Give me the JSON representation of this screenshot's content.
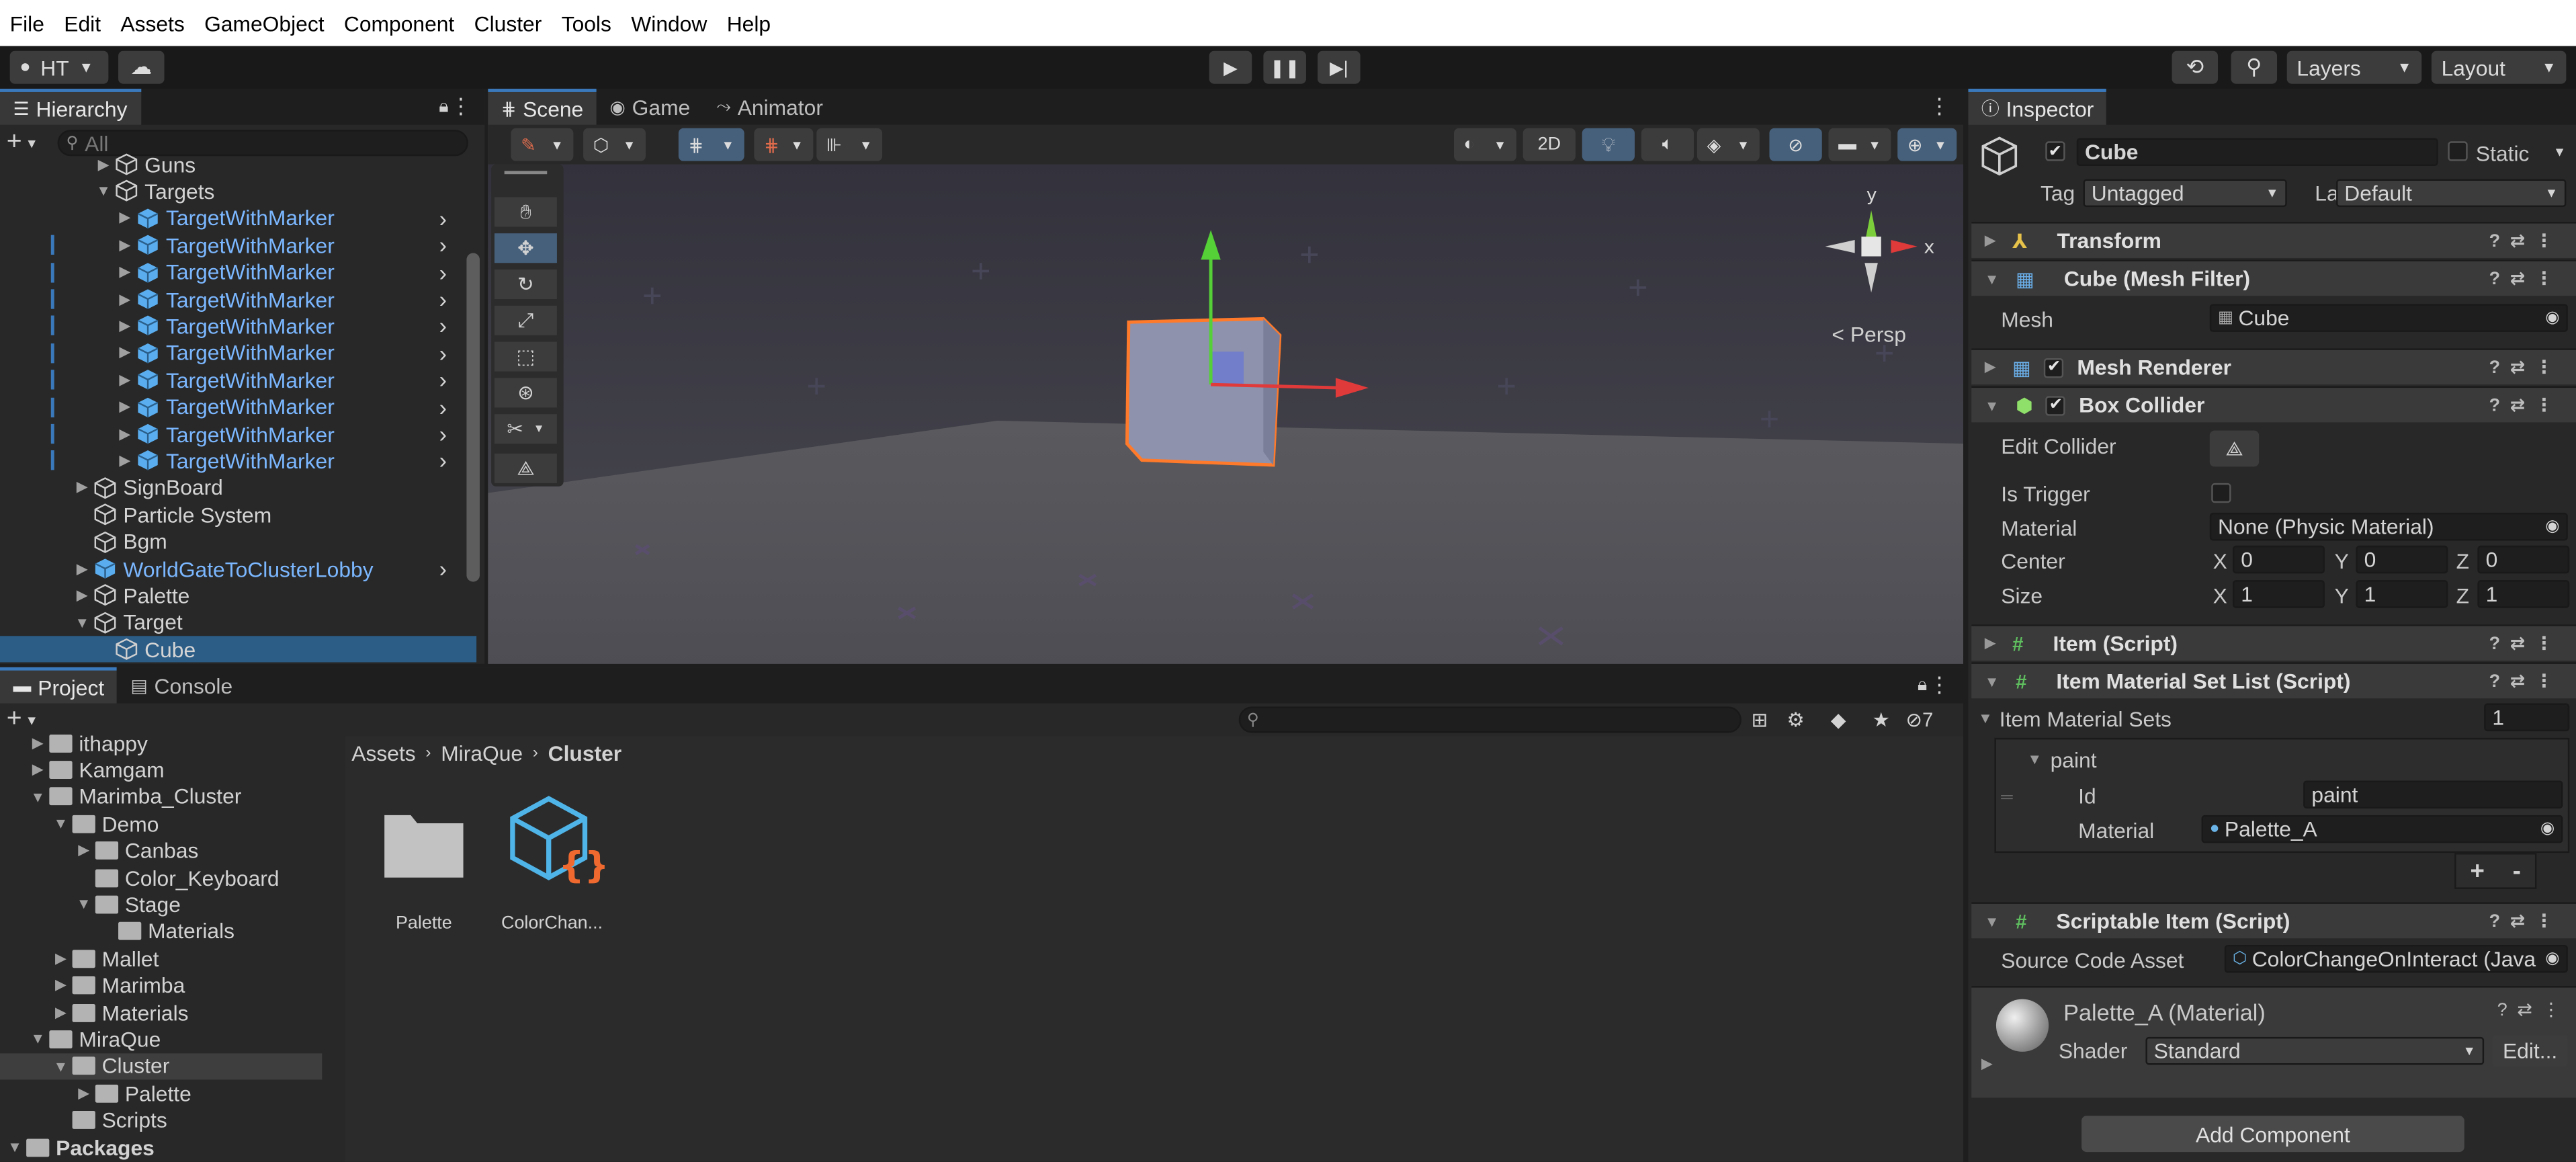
{
  "menu": [
    "File",
    "Edit",
    "Assets",
    "GameObject",
    "Component",
    "Cluster",
    "Tools",
    "Window",
    "Help"
  ],
  "toolbar": {
    "account": "HT",
    "layers": "Layers",
    "layout": "Layout"
  },
  "hierarchy": {
    "tab": "Hierarchy",
    "search_placeholder": "All",
    "items": [
      {
        "label": "Guns",
        "indent": 4,
        "prefab": false,
        "cube": false
      },
      {
        "label": "Targets",
        "indent": 4,
        "prefab": false,
        "cube": false,
        "open": true
      },
      {
        "label": "TargetWithMarker",
        "indent": 5,
        "prefab": true
      },
      {
        "label": "TargetWithMarker",
        "indent": 5,
        "prefab": true
      },
      {
        "label": "TargetWithMarker",
        "indent": 5,
        "prefab": true
      },
      {
        "label": "TargetWithMarker",
        "indent": 5,
        "prefab": true
      },
      {
        "label": "TargetWithMarker",
        "indent": 5,
        "prefab": true
      },
      {
        "label": "TargetWithMarker",
        "indent": 5,
        "prefab": true
      },
      {
        "label": "TargetWithMarker",
        "indent": 5,
        "prefab": true
      },
      {
        "label": "TargetWithMarker",
        "indent": 5,
        "prefab": true
      },
      {
        "label": "TargetWithMarker",
        "indent": 5,
        "prefab": true
      },
      {
        "label": "TargetWithMarker",
        "indent": 5,
        "prefab": true
      },
      {
        "label": "SignBoard",
        "indent": 3,
        "prefab": false
      },
      {
        "label": "Particle System",
        "indent": 3,
        "prefab": false
      },
      {
        "label": "Bgm",
        "indent": 3,
        "prefab": false
      },
      {
        "label": "WorldGateToClusterLobby",
        "indent": 3,
        "prefab": true
      },
      {
        "label": "Palette",
        "indent": 3,
        "prefab": false
      },
      {
        "label": "Target",
        "indent": 3,
        "prefab": false,
        "open": true
      },
      {
        "label": "Cube",
        "indent": 4,
        "prefab": false,
        "selected": true
      }
    ]
  },
  "scene": {
    "tabs": [
      "Scene",
      "Game",
      "Animator"
    ],
    "btn_2d": "2D",
    "persp": "Persp",
    "axis_x": "x",
    "axis_y": "y"
  },
  "project": {
    "tabs": [
      "Project",
      "Console"
    ],
    "hidden_count": "7",
    "breadcrumb": [
      "Assets",
      "MiraQue",
      "Cluster"
    ],
    "tree": [
      {
        "label": "ithappy",
        "indent": 1
      },
      {
        "label": "Kamgam",
        "indent": 1
      },
      {
        "label": "Marimba_Cluster",
        "indent": 1,
        "open": true
      },
      {
        "label": "Demo",
        "indent": 2,
        "open": true
      },
      {
        "label": "Canbas",
        "indent": 3
      },
      {
        "label": "Color_Keyboard",
        "indent": 3,
        "leaf": true
      },
      {
        "label": "Stage",
        "indent": 3,
        "open": true
      },
      {
        "label": "Materials",
        "indent": 4,
        "leaf": true
      },
      {
        "label": "Mallet",
        "indent": 2
      },
      {
        "label": "Marimba",
        "indent": 2
      },
      {
        "label": "Materials",
        "indent": 2
      },
      {
        "label": "MiraQue",
        "indent": 1,
        "open": true
      },
      {
        "label": "Cluster",
        "indent": 2,
        "open": true,
        "selected": true
      },
      {
        "label": "Palette",
        "indent": 3
      },
      {
        "label": "Scripts",
        "indent": 2,
        "leaf": true
      },
      {
        "label": "Packages",
        "indent": 0,
        "open": true,
        "bold": true
      }
    ],
    "assets": [
      {
        "label": "Palette",
        "kind": "folder"
      },
      {
        "label": "ColorChan...",
        "kind": "script"
      }
    ]
  },
  "inspector": {
    "tab": "Inspector",
    "object_name": "Cube",
    "static_label": "Static",
    "tag_label": "Tag",
    "tag_value": "Untagged",
    "layer_label": "Layer",
    "layer_value": "Default",
    "transform": "Transform",
    "mesh_filter": "Cube (Mesh Filter)",
    "mesh_label": "Mesh",
    "mesh_value": "Cube",
    "mesh_renderer": "Mesh Renderer",
    "box_collider": "Box Collider",
    "edit_collider": "Edit Collider",
    "is_trigger": "Is Trigger",
    "material_label": "Material",
    "material_value": "None (Physic Material)",
    "center_label": "Center",
    "center": {
      "x": "0",
      "y": "0",
      "z": "0"
    },
    "size_label": "Size",
    "size": {
      "x": "1",
      "y": "1",
      "z": "1"
    },
    "item_script": "Item (Script)",
    "item_material_set_list": "Item Material Set List (Script)",
    "item_material_sets_label": "Item Material Sets",
    "item_material_sets_count": "1",
    "paint_label": "paint",
    "id_label": "Id",
    "id_value": "paint",
    "mat_label": "Material",
    "mat_value": "Palette_A",
    "plus": "+",
    "minus": "-",
    "scriptable_item": "Scriptable Item (Script)",
    "source_code_label": "Source Code Asset",
    "source_code_value": "ColorChangeOnInteract (Java",
    "material_asset_name": "Palette_A (Material)",
    "shader_label": "Shader",
    "shader_value": "Standard",
    "edit_btn": "Edit...",
    "add_component": "Add Component",
    "axis_x": "X",
    "axis_y": "Y",
    "axis_z": "Z"
  }
}
